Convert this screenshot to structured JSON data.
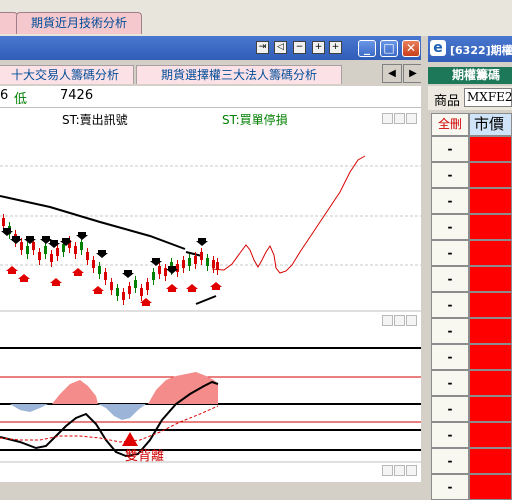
{
  "top_tabs": [
    {
      "label": ""
    },
    {
      "label": "期貨近月技術分析"
    }
  ],
  "window": {
    "toolbar_buttons": [
      "⇥",
      "◁",
      "−",
      "+"
    ],
    "min_label": "_",
    "max_label": "□",
    "close_label": "✕"
  },
  "sub_tabs": [
    {
      "label": "十大交易人籌碼分析"
    },
    {
      "label": "期貨選擇權三大法人籌碼分析"
    }
  ],
  "nav": {
    "left": "◀",
    "right": "▶"
  },
  "quote": {
    "prefix": "6",
    "low_label": "低",
    "low_value": "7426"
  },
  "chart": {
    "sell_signal": "ST:賣出訊號",
    "buy_stop": "ST:買單停損",
    "divergence_label": "雙背離",
    "colors": {
      "sell": "#000000",
      "buy_stop": "#008000",
      "forecast": "#d80000",
      "pos_area": "#f48c8c",
      "neg_area": "#9cb4d8"
    }
  },
  "right_panel": {
    "title": "[6322]期權",
    "header": "期權籌碼",
    "product_label": "商品",
    "product_value": "MXFE2",
    "col_delete": "全刪",
    "col_market": "市價",
    "rows": [
      "-",
      "-",
      "-",
      "-",
      "-",
      "-",
      "-",
      "-",
      "-",
      "-",
      "-",
      "-",
      "-",
      "-"
    ]
  }
}
